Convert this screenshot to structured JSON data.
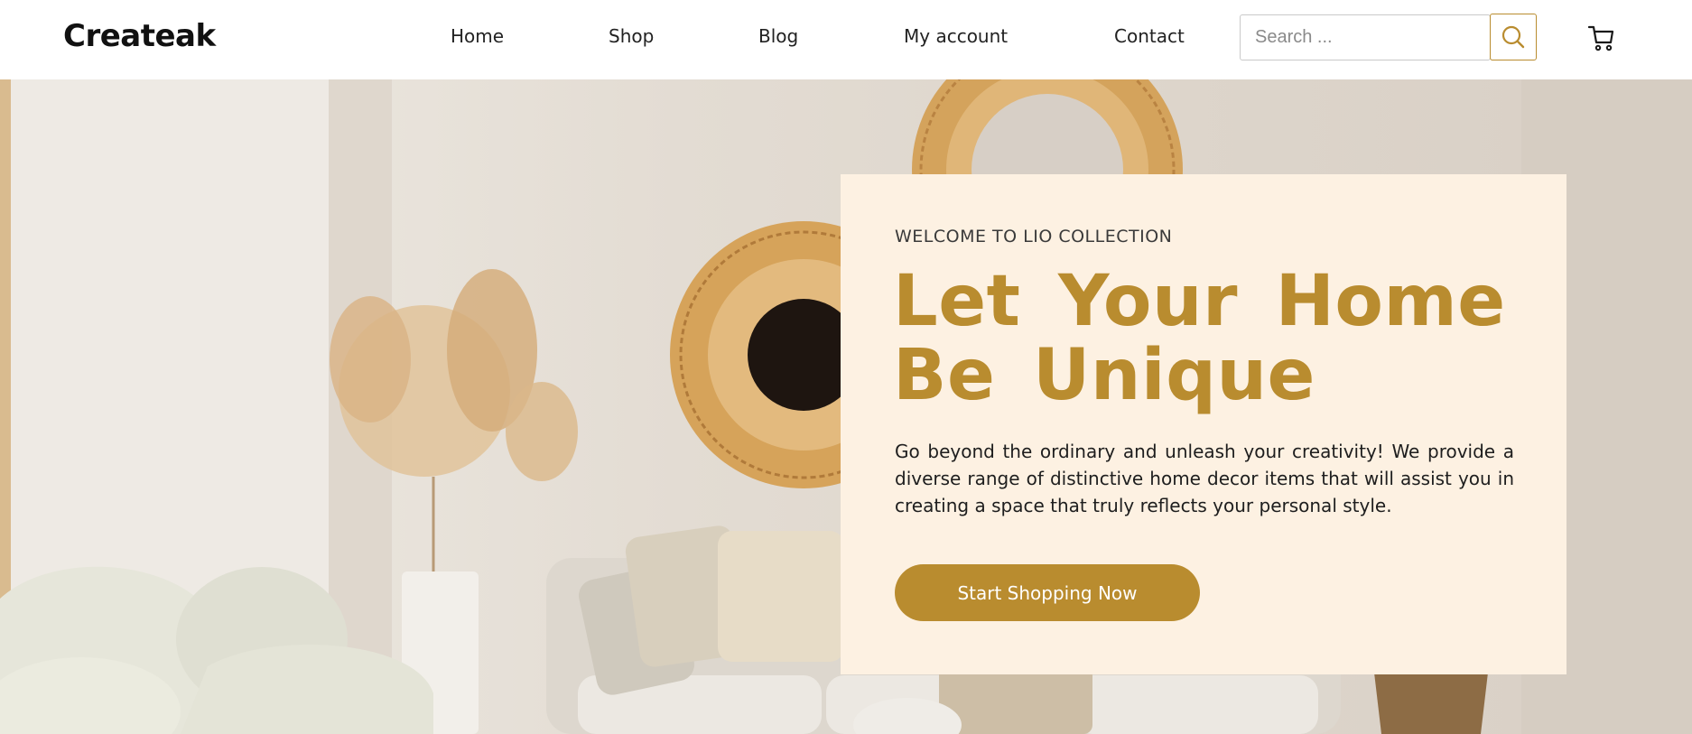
{
  "brand": {
    "logo_text": "Createak",
    "accent_color": "#b98c2f",
    "card_bg": "#fdf1e2"
  },
  "nav": {
    "items": [
      {
        "label": "Home"
      },
      {
        "label": "Shop"
      },
      {
        "label": "Blog"
      },
      {
        "label": "My account"
      },
      {
        "label": "Contact"
      }
    ]
  },
  "search": {
    "placeholder": "Search ...",
    "value": "",
    "button_icon": "search-icon"
  },
  "cart": {
    "icon": "cart-icon"
  },
  "hero": {
    "eyebrow": "WELCOME TO LIO COLLECTION",
    "headline": "Let Your Home Be Unique",
    "body": "Go beyond the ordinary and unleash your creativity! We provide a diverse range of distinctive home decor items that will assist you in creating a space that truly reflects your personal style.",
    "cta_label": "Start Shopping Now",
    "background_image": "living-room-photo"
  }
}
